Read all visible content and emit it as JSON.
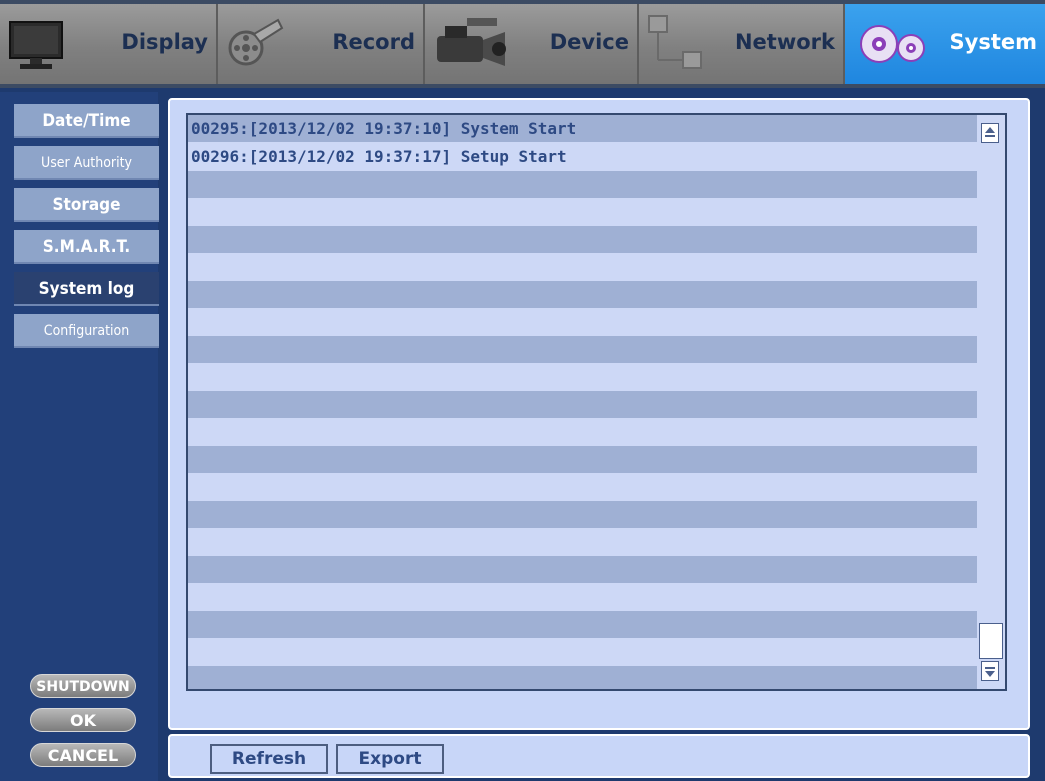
{
  "tabs": [
    {
      "label": "Display",
      "icon": "monitor-icon"
    },
    {
      "label": "Record",
      "icon": "film-reel-icon"
    },
    {
      "label": "Device",
      "icon": "camcorder-icon"
    },
    {
      "label": "Network",
      "icon": "network-icon"
    },
    {
      "label": "System",
      "icon": "gears-icon",
      "active": true
    }
  ],
  "sidebar": {
    "items": [
      {
        "label": "Date/Time"
      },
      {
        "label": "User Authority"
      },
      {
        "label": "Storage"
      },
      {
        "label": "S.M.A.R.T."
      },
      {
        "label": "System log",
        "selected": true
      },
      {
        "label": "Configuration"
      }
    ],
    "shutdown_label": "SHUTDOWN",
    "ok_label": "OK",
    "cancel_label": "CANCEL"
  },
  "log": {
    "entries": [
      "00295:[2013/12/02 19:37:10] System Start",
      "00296:[2013/12/02 19:37:17] Setup Start"
    ]
  },
  "actions": {
    "refresh_label": "Refresh",
    "export_label": "Export"
  },
  "colors": {
    "active_tab": "#1f86df",
    "panel_bg": "#c8d6f8",
    "stripe": "#9fb0d4",
    "menu_item": "#8ea4c9",
    "menu_selected": "#2a4170",
    "text_blue": "#2e4a84"
  }
}
